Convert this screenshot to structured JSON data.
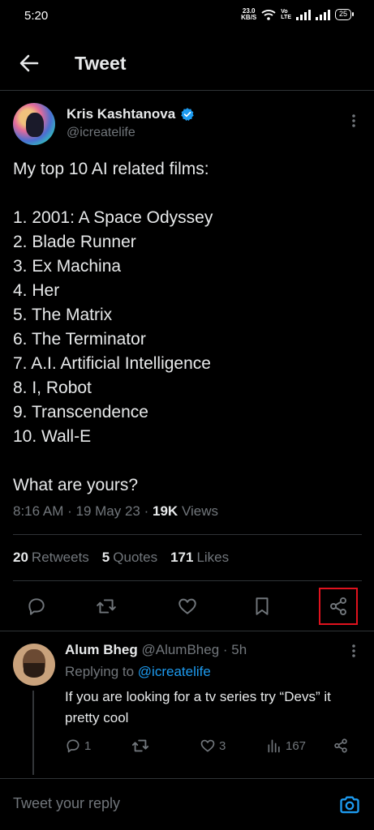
{
  "status_bar": {
    "time": "5:20",
    "speed_value": "23.0",
    "speed_unit": "KB/S",
    "volte_top": "Vo",
    "volte_bottom": "LTE",
    "battery": "25"
  },
  "header": {
    "title": "Tweet"
  },
  "tweet": {
    "author_name": "Kris Kashtanova",
    "author_handle": "@icreatelife",
    "lines": [
      "My top 10 AI related films:",
      "",
      "1. 2001: A Space Odyssey",
      "2. Blade Runner",
      "3. Ex Machina",
      "4. Her",
      "5. The Matrix",
      "6. The Terminator",
      "7. A.I. Artificial Intelligence",
      "8. I, Robot",
      "9. Transcendence",
      "10. Wall-E",
      "",
      "What are yours?"
    ],
    "time": "8:16 AM",
    "date": "19 May 23",
    "views_count": "19K",
    "views_label": "Views",
    "retweets_count": "20",
    "retweets_label": "Retweets",
    "quotes_count": "5",
    "quotes_label": "Quotes",
    "likes_count": "171",
    "likes_label": "Likes"
  },
  "reply": {
    "author_name": "Alum Bheg",
    "author_handle": "@AlumBheg",
    "time": "5h",
    "replying_label": "Replying to",
    "replying_handle": "@icreatelife",
    "text": "If you are looking for a tv series try “Devs” it pretty cool",
    "reply_count": "1",
    "retweet_count": "",
    "like_count": "3",
    "view_count": "167"
  },
  "composer": {
    "placeholder": "Tweet your reply"
  },
  "colors": {
    "background": "#000000",
    "accent": "#1d9bf0",
    "muted": "#71767b",
    "highlight_box": "#e0121e"
  },
  "icons": [
    "arrow-left-icon",
    "verified-badge-icon",
    "more-vertical-icon",
    "reply-icon",
    "retweet-icon",
    "like-icon",
    "bookmark-icon",
    "share-icon",
    "views-icon",
    "camera-icon"
  ]
}
